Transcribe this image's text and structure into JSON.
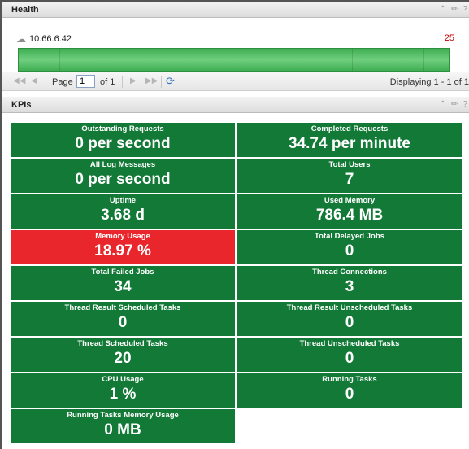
{
  "health": {
    "title": "Health",
    "host": "10.66.6.42",
    "count": "25"
  },
  "pager": {
    "page_label": "Page",
    "page_value": "1",
    "of_label": "of 1",
    "display_text": "Displaying 1 - 1 of 1"
  },
  "kpis": {
    "title": "KPIs",
    "tiles": [
      {
        "label": "Outstanding Requests",
        "value": "0 per second",
        "status": "ok"
      },
      {
        "label": "Completed Requests",
        "value": "34.74 per minute",
        "status": "ok"
      },
      {
        "label": "All Log Messages",
        "value": "0 per second",
        "status": "ok"
      },
      {
        "label": "Total Users",
        "value": "7",
        "status": "ok"
      },
      {
        "label": "Uptime",
        "value": "3.68 d",
        "status": "ok"
      },
      {
        "label": "Used Memory",
        "value": "786.4 MB",
        "status": "ok"
      },
      {
        "label": "Memory Usage",
        "value": "18.97 %",
        "status": "alert"
      },
      {
        "label": "Total Delayed Jobs",
        "value": "0",
        "status": "ok"
      },
      {
        "label": "Total Failed Jobs",
        "value": "34",
        "status": "ok"
      },
      {
        "label": "Thread Connections",
        "value": "3",
        "status": "ok"
      },
      {
        "label": "Thread Result Scheduled Tasks",
        "value": "0",
        "status": "ok"
      },
      {
        "label": "Thread Result Unscheduled Tasks",
        "value": "0",
        "status": "ok"
      },
      {
        "label": "Thread Scheduled Tasks",
        "value": "20",
        "status": "ok"
      },
      {
        "label": "Thread Unscheduled Tasks",
        "value": "0",
        "status": "ok"
      },
      {
        "label": "CPU Usage",
        "value": "1 %",
        "status": "ok"
      },
      {
        "label": "Running Tasks",
        "value": "0",
        "status": "ok"
      },
      {
        "label": "Running Tasks Memory Usage",
        "value": "0 MB",
        "status": "ok"
      }
    ]
  },
  "colors": {
    "ok": "#127a36",
    "alert": "#e8262b",
    "health_bar": "#4fbf60"
  },
  "icons": {
    "host": "cloud-icon",
    "panel_tools": [
      "collapse-icon",
      "edit-icon",
      "help-icon"
    ],
    "pager": [
      "first-page-icon",
      "prev-page-icon",
      "next-page-icon",
      "last-page-icon",
      "refresh-icon"
    ]
  }
}
